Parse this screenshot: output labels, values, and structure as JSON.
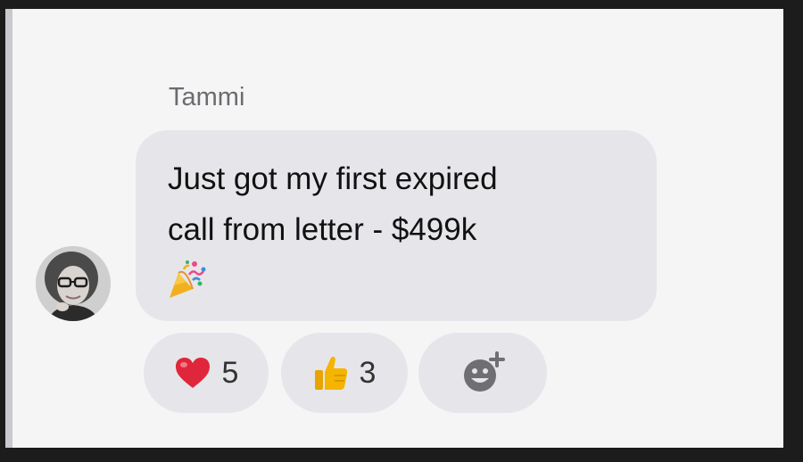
{
  "message": {
    "sender": "Tammi",
    "text": "Just got my first expired\ncall from letter - $499k",
    "trailing_emoji": "party-popper",
    "avatar": "user-avatar-photo"
  },
  "reactions": [
    {
      "emoji": "heart",
      "count": "5"
    },
    {
      "emoji": "thumbs-up",
      "count": "3"
    }
  ],
  "add_reaction": {
    "icon": "add-reaction-icon"
  },
  "colors": {
    "bubble": "#e6e6ea",
    "background": "#f5f5f6",
    "heart": "#e0263b",
    "thumb": "#f4b400",
    "add_icon": "#6e6e73"
  }
}
